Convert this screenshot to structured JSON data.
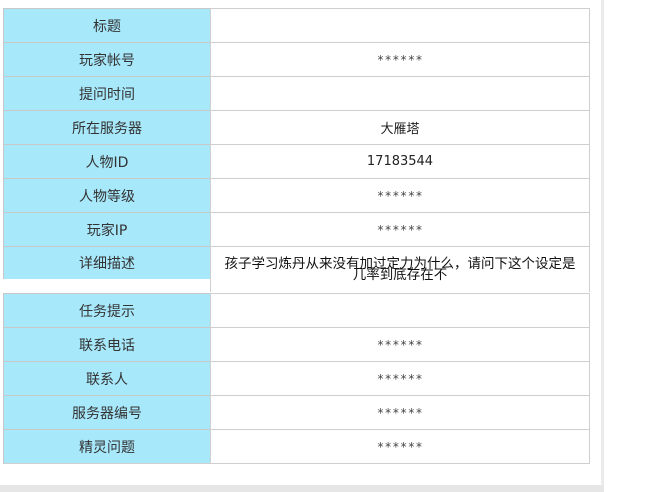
{
  "form": {
    "rows": [
      {
        "label": "标题",
        "value": ""
      },
      {
        "label": "玩家帐号",
        "value": "******"
      },
      {
        "label": "提问时间",
        "value": ""
      },
      {
        "label": "所在服务器",
        "value": "大雁塔"
      },
      {
        "label": "人物ID",
        "value": "17183544"
      },
      {
        "label": "人物等级",
        "value": "******"
      },
      {
        "label": "玩家IP",
        "value": "******"
      },
      {
        "label": "详细描述",
        "value": "孩子学习炼丹从来没有加过定力为什么，请问下这个设定是几率到底存在不"
      },
      {
        "label": "任务提示",
        "value": ""
      },
      {
        "label": "联系电话",
        "value": "******"
      },
      {
        "label": "联系人",
        "value": "******"
      },
      {
        "label": "服务器编号",
        "value": "******"
      },
      {
        "label": "精灵问题",
        "value": "******"
      }
    ]
  },
  "colors": {
    "label_bg": "#a8e8fb",
    "border": "#cfcfcf"
  }
}
